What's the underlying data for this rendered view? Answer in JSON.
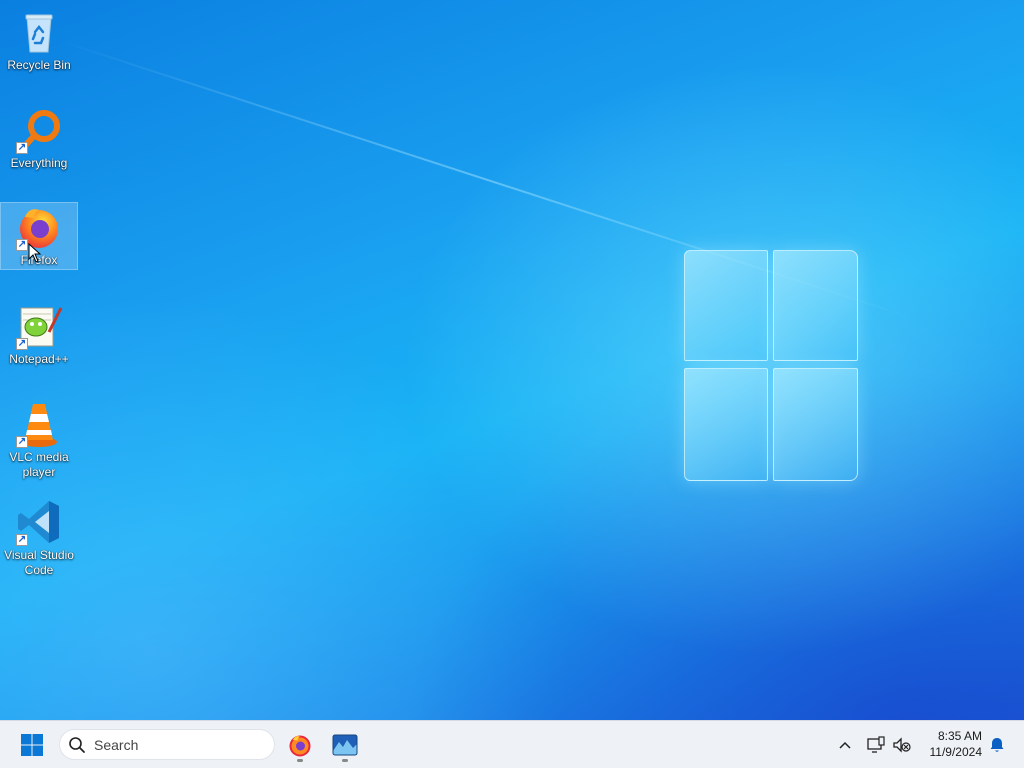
{
  "desktop": {
    "icons": [
      {
        "label": "Recycle Bin",
        "icon": "recycle-bin-icon"
      },
      {
        "label": "Everything",
        "icon": "everything-search-icon"
      },
      {
        "label": "Firefox",
        "icon": "firefox-icon"
      },
      {
        "label": "Notepad++",
        "icon": "notepad-plus-plus-icon"
      },
      {
        "label": "VLC media player",
        "icon": "vlc-cone-icon"
      },
      {
        "label": "Visual Studio Code",
        "icon": "vscode-icon"
      }
    ],
    "selected_icon": "Firefox"
  },
  "taskbar": {
    "search_placeholder": "Search",
    "pinned_apps": [
      {
        "name": "Firefox",
        "icon": "firefox-icon",
        "running": true
      },
      {
        "name": "Photos",
        "icon": "photos-icon",
        "running": true
      }
    ],
    "tray": {
      "clock_time": "8:35 AM",
      "clock_date": "11/9/2024"
    }
  },
  "colors": {
    "wallpaper_accent": "#17b3f5",
    "taskbar_bg": "#eef1f6",
    "start_blue": "#0a78d4"
  }
}
